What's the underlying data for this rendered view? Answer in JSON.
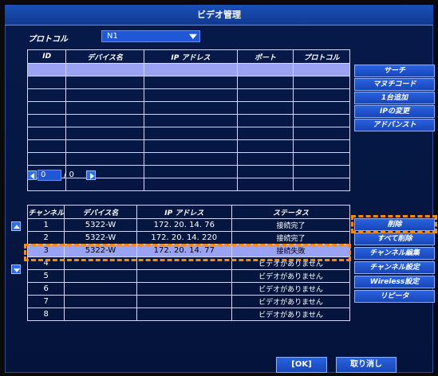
{
  "window": {
    "title": "ビデオ管理"
  },
  "protocol": {
    "label": "プロトコル",
    "value": "N1"
  },
  "device_table": {
    "headers": [
      "ID",
      "デバイス名",
      "IP アドレス",
      "ポート",
      "プロトコル"
    ],
    "rows": [
      [
        "",
        "",
        "",
        "",
        ""
      ],
      [
        "",
        "",
        "",
        "",
        ""
      ],
      [
        "",
        "",
        "",
        "",
        ""
      ],
      [
        "",
        "",
        "",
        "",
        ""
      ],
      [
        "",
        "",
        "",
        "",
        ""
      ],
      [
        "",
        "",
        "",
        "",
        ""
      ],
      [
        "",
        "",
        "",
        "",
        ""
      ],
      [
        "",
        "",
        "",
        "",
        ""
      ],
      [
        "",
        "",
        "",
        "",
        ""
      ],
      [
        "",
        "",
        "",
        "",
        ""
      ]
    ]
  },
  "top_buttons": [
    "サーチ",
    "マヌチコード",
    "1台追加",
    "IPの変更",
    "アドバンスト"
  ],
  "pager": {
    "current": "0",
    "separator": "/ 0"
  },
  "channel_table": {
    "headers": [
      "チャンネル",
      "デバイス名",
      "IP アドレス",
      "ステータス"
    ],
    "rows": [
      [
        "1",
        "5322-W",
        "172. 20. 14. 76",
        "接続完了"
      ],
      [
        "2",
        "5322-W",
        "172. 20. 14. 220",
        "接続完了"
      ],
      [
        "3",
        "5322-W",
        "172. 20. 14. 77",
        "接続失敗"
      ],
      [
        "4",
        "",
        "",
        "ビデオがありません"
      ],
      [
        "5",
        "",
        "",
        "ビデオがありません"
      ],
      [
        "6",
        "",
        "",
        "ビデオがありません"
      ],
      [
        "7",
        "",
        "",
        "ビデオがありません"
      ],
      [
        "8",
        "",
        "",
        "ビデオがありません"
      ]
    ]
  },
  "side_buttons": [
    "削除",
    "すべて削除",
    "チャンネル編集",
    "チャンネル設定",
    "Wireless設定",
    "リピータ"
  ],
  "footer": {
    "ok": "[OK]",
    "cancel": "取り消し"
  },
  "colors": {
    "accent": "#1f57d6",
    "selection": "#9aa2f4",
    "highlight": "#ff8a00"
  }
}
